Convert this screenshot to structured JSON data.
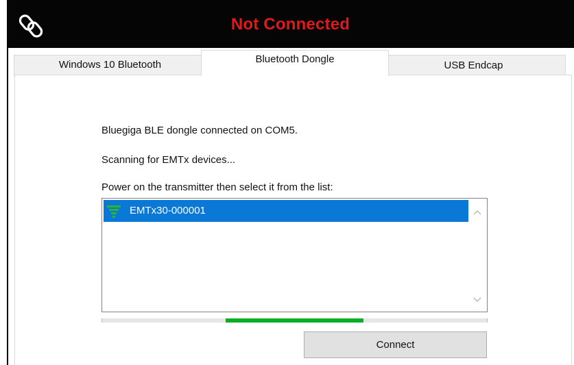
{
  "header": {
    "status_title": "Not Connected",
    "logo_icon": "link-chain-icon",
    "background_color": "#050505",
    "status_color": "#e0191b"
  },
  "tabs": [
    {
      "label": "Windows 10 Bluetooth",
      "active": false
    },
    {
      "label": "Bluetooth Dongle",
      "active": true
    },
    {
      "label": "USB Endcap",
      "active": false
    }
  ],
  "dongle_panel": {
    "dongle_status": "Bluegiga BLE dongle connected on COM5.",
    "scan_status": "Scanning for EMTx devices...",
    "instruction": "Power on the transmitter then select it from the list:",
    "devices": [
      {
        "name": "EMTx30-000001",
        "icon": "signal-strength-icon",
        "selected": true
      }
    ],
    "selection_color": "#0a78d7",
    "signal_color": "#2db52d",
    "progress": {
      "indeterminate": true,
      "fill_start": 0.32,
      "fill_end": 0.68,
      "color": "#06b025"
    },
    "connect_label": "Connect"
  }
}
